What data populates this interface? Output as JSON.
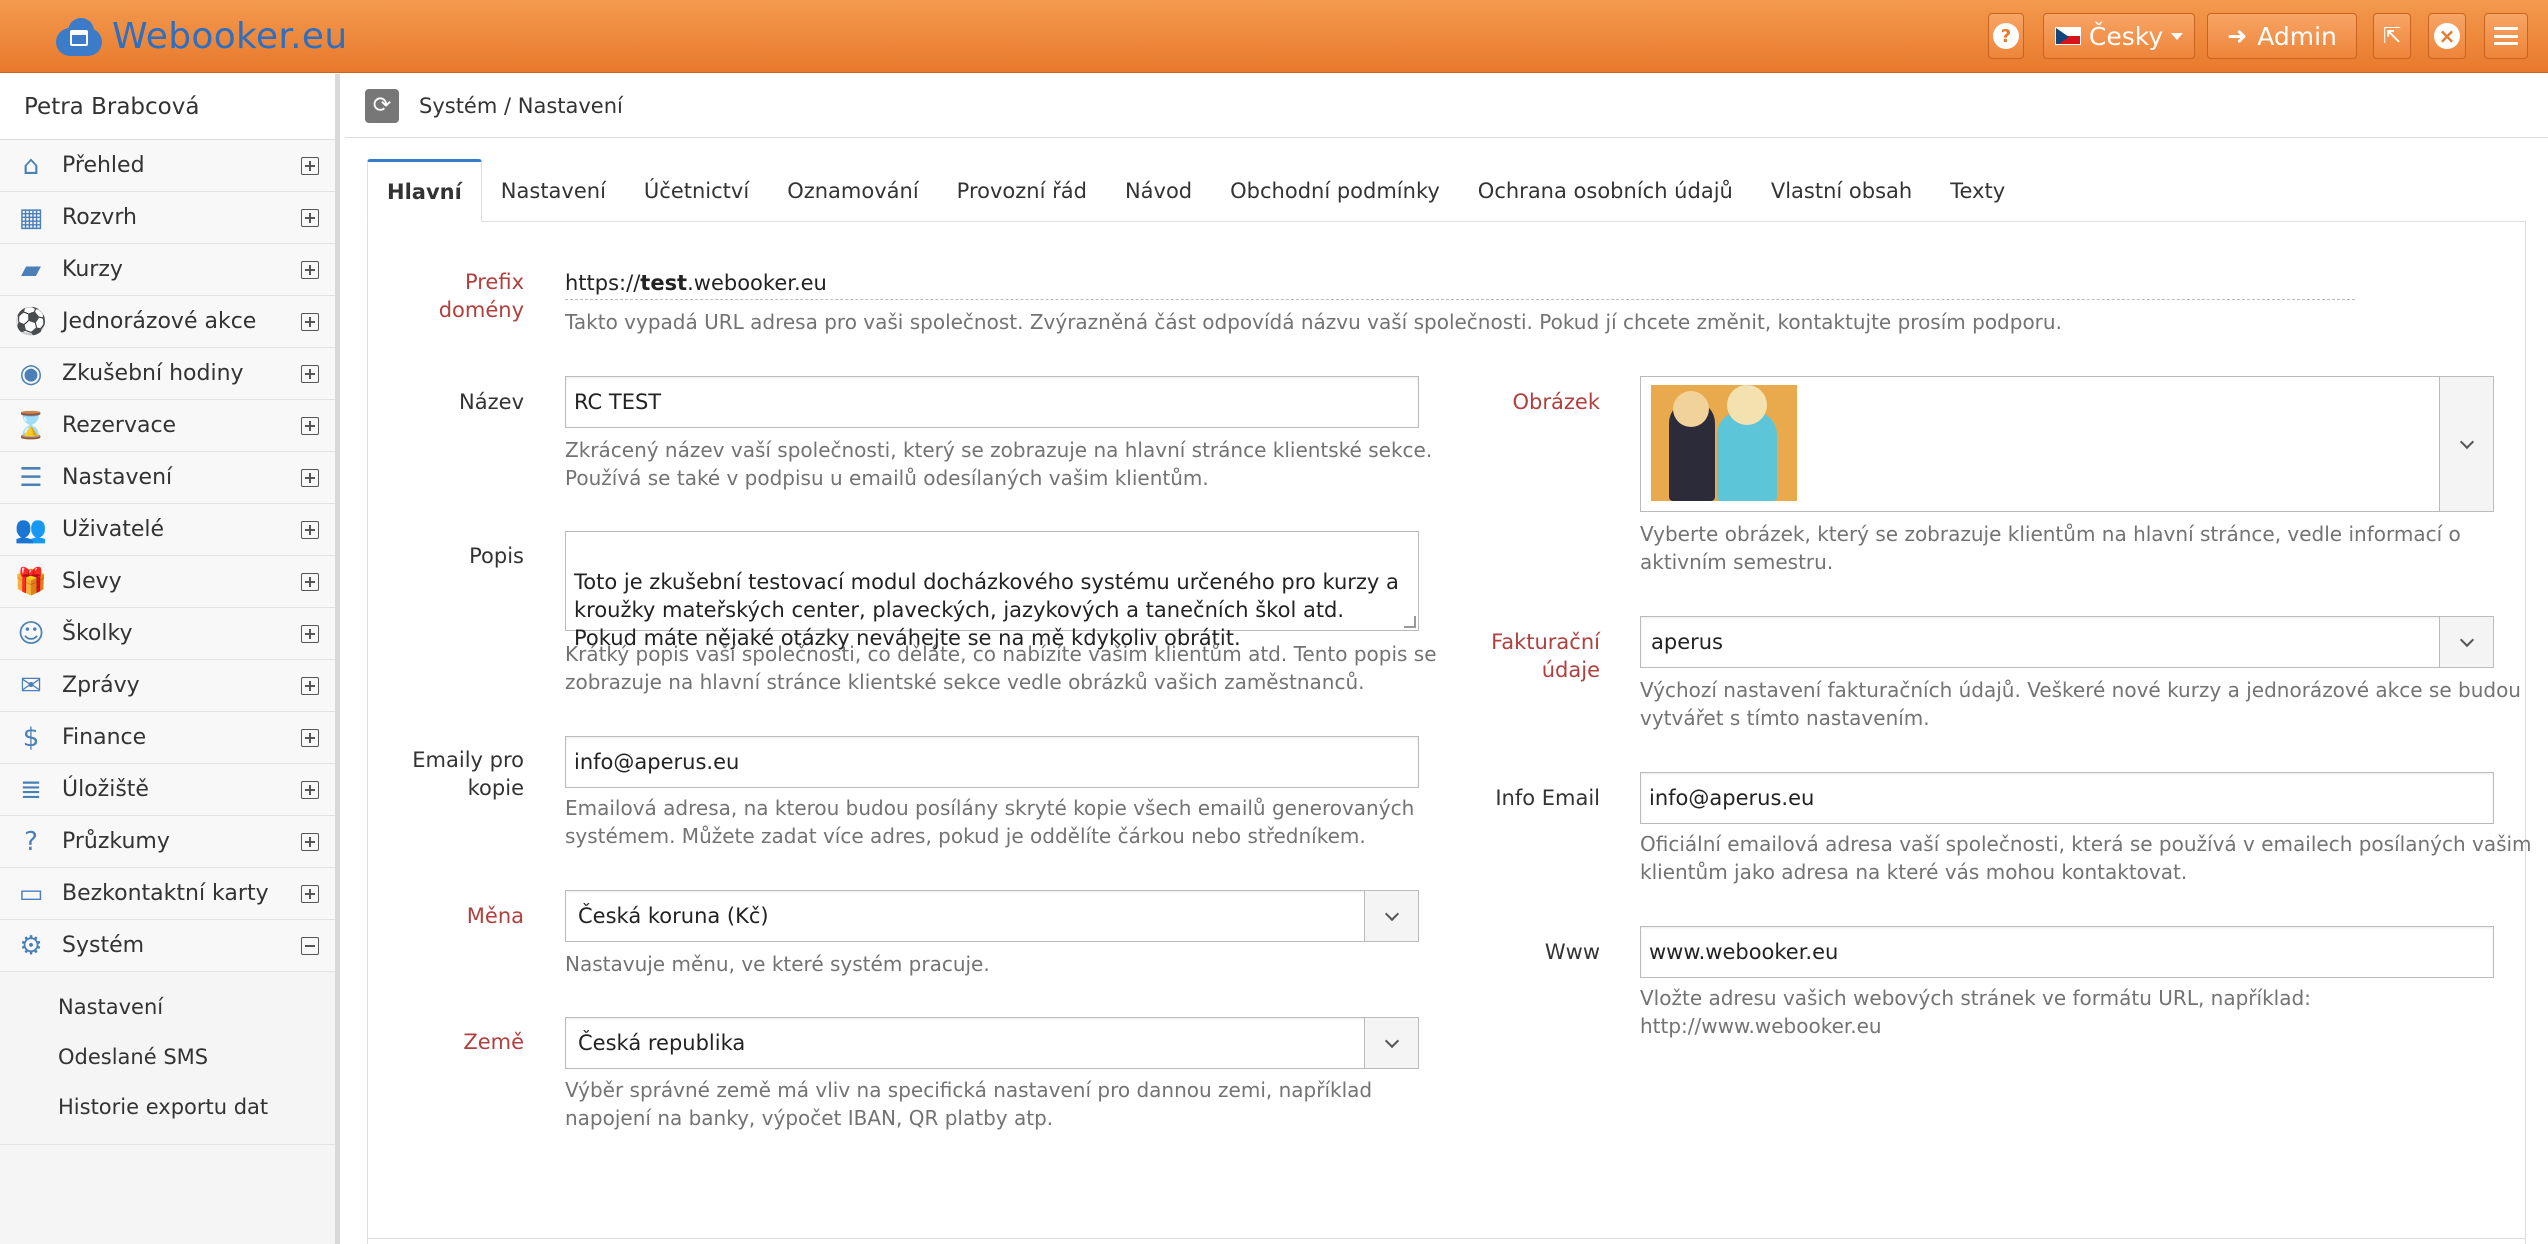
{
  "app": {
    "logo_text": "Webooker.eu",
    "language_label": "Česky",
    "admin_label": "Admin",
    "help_glyph": "?",
    "close_glyph": "×",
    "accent_color": "#e8792c",
    "brand_color": "#2f6fbf"
  },
  "sidebar": {
    "user_name": "Petra Brabcová",
    "items": [
      {
        "label": "Přehled",
        "icon": "home-icon",
        "glyph": "⌂"
      },
      {
        "label": "Rozvrh",
        "icon": "calendar-icon",
        "glyph": "▦"
      },
      {
        "label": "Kurzy",
        "icon": "book-icon",
        "glyph": "▰"
      },
      {
        "label": "Jednorázové akce",
        "icon": "ball-icon",
        "glyph": "⚽"
      },
      {
        "label": "Zkušební hodiny",
        "icon": "eye-icon",
        "glyph": "◉"
      },
      {
        "label": "Rezervace",
        "icon": "hourglass-icon",
        "glyph": "⌛"
      },
      {
        "label": "Nastavení",
        "icon": "list-icon",
        "glyph": "☰"
      },
      {
        "label": "Uživatelé",
        "icon": "users-icon",
        "glyph": "👥"
      },
      {
        "label": "Slevy",
        "icon": "gift-icon",
        "glyph": "🎁"
      },
      {
        "label": "Školky",
        "icon": "child-icon",
        "glyph": "☺"
      },
      {
        "label": "Zprávy",
        "icon": "envelope-icon",
        "glyph": "✉"
      },
      {
        "label": "Finance",
        "icon": "money-icon",
        "glyph": "$"
      },
      {
        "label": "Úložiště",
        "icon": "database-icon",
        "glyph": "≣"
      },
      {
        "label": "Průzkumy",
        "icon": "question-icon",
        "glyph": "?"
      },
      {
        "label": "Bezkontaktní karty",
        "icon": "card-icon",
        "glyph": "▭"
      },
      {
        "label": "Systém",
        "icon": "cogs-icon",
        "glyph": "⚙"
      }
    ],
    "sub_items": [
      "Nastavení",
      "Odeslané SMS",
      "Historie exportu dat"
    ]
  },
  "breadcrumb": "Systém / Nastavení",
  "tabs": [
    "Hlavní",
    "Nastavení",
    "Účetnictví",
    "Oznamování",
    "Provozní řád",
    "Návod",
    "Obchodní podmínky",
    "Ochrana osobních údajů",
    "Vlastní obsah",
    "Texty"
  ],
  "form": {
    "prefix": {
      "label_line1": "Prefix",
      "label_line2": "domény",
      "url_start": "https://",
      "url_bold": "test",
      "url_end": ".webooker.eu",
      "help": "Takto vypadá URL adresa pro vaši společnost. Zvýrazněná část odpovídá názvu vaší společnosti. Pokud jí chcete změnit, kontaktujte prosím podporu."
    },
    "nazev": {
      "label": "Název",
      "value": "RC TEST",
      "help_line1": "Zkrácený název vaší společnosti, který se zobrazuje na hlavní stránce klientské sekce.",
      "help_line2": "Používá se také v podpisu u emailů odesílaných vašim klientům."
    },
    "popis": {
      "label": "Popis",
      "value": "Toto je zkušební testovací modul docházkového systému určeného pro kurzy a\nkroužky mateřských center, plaveckých, jazykových a tanečních škol atd.\nPokud máte nějaké otázky neváhejte se na mě kdykoliv obrátit.",
      "help_line1": "Krátký popis vaší společnosti, co děláte, co nabízíte vašim klientům atd. Tento popis se",
      "help_line2": "zobrazuje na hlavní stránce klientské sekce vedle obrázků vašich zaměstnanců."
    },
    "emaily": {
      "label_line1": "Emaily pro",
      "label_line2": "kopie",
      "value": "info@aperus.eu",
      "help_line1": "Emailová adresa, na kterou budou posílány skryté kopie všech emailů generovaných",
      "help_line2": "systémem. Můžete zadat více adres, pokud je oddělíte čárkou nebo středníkem."
    },
    "mena": {
      "label": "Měna",
      "value": "Česká koruna (Kč)",
      "help": "Nastavuje měnu, ve které systém pracuje."
    },
    "zeme": {
      "label": "Země",
      "value": "Česká republika",
      "help_line1": "Výběr správné země má vliv na specifická nastavení pro dannou zemi, například",
      "help_line2": "napojení na banky, výpočet IBAN, QR platby atp."
    },
    "obrazek": {
      "label": "Obrázek",
      "help_line1": "Vyberte obrázek, který se zobrazuje klientům na hlavní stránce, vedle informací o",
      "help_line2": "aktivním semestru."
    },
    "fakturacni": {
      "label_line1": "Fakturační",
      "label_line2": "údaje",
      "value": "aperus",
      "help_line1": "Výchozí nastavení fakturačních údajů. Veškeré nové kurzy a jednorázové akce se budou",
      "help_line2": "vytvářet s tímto nastavením."
    },
    "info_email": {
      "label": "Info Email",
      "value": "info@aperus.eu",
      "help_line1": "Oficiální emailová adresa vaší společnosti, která se používá v emailech posílaných vašim",
      "help_line2": "klientům jako adresa na které vás mohou kontaktovat."
    },
    "www": {
      "label": "Www",
      "value": "www.webooker.eu",
      "help_line1": "Vložte adresu vašich webových stránek ve formátu URL, například:",
      "help_line2": "http://www.webooker.eu"
    }
  }
}
